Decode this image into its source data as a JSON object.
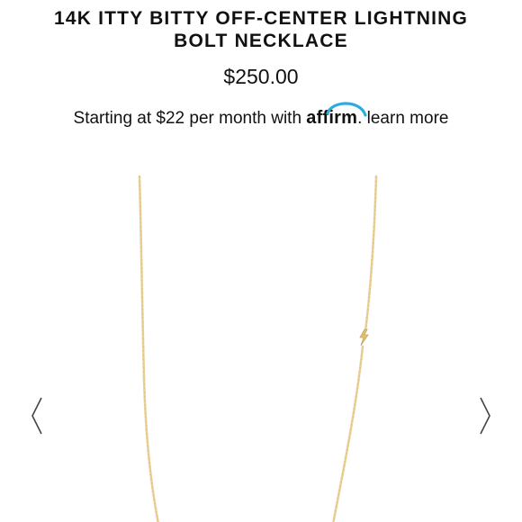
{
  "product": {
    "title_line1": "14K ITTY BITTY OFF-CENTER LIGHTNING",
    "title_line2": "BOLT NECKLACE",
    "price": "$250.00"
  },
  "financing": {
    "prefix": "Starting at $22 per month with",
    "brand": "affirm",
    "separator": ".",
    "learn_more": "learn more"
  },
  "gallery": {
    "image": "gold-chain-necklace-with-lightning-bolt-charm",
    "prev_icon": "chevron-left-icon",
    "next_icon": "chevron-right-icon"
  },
  "colors": {
    "text": "#111111",
    "affirm_arc": "#2eaadc",
    "chain_gold": "#e9cf96",
    "chain_gold_dark": "#d7b46a",
    "arrow": "#444444"
  }
}
